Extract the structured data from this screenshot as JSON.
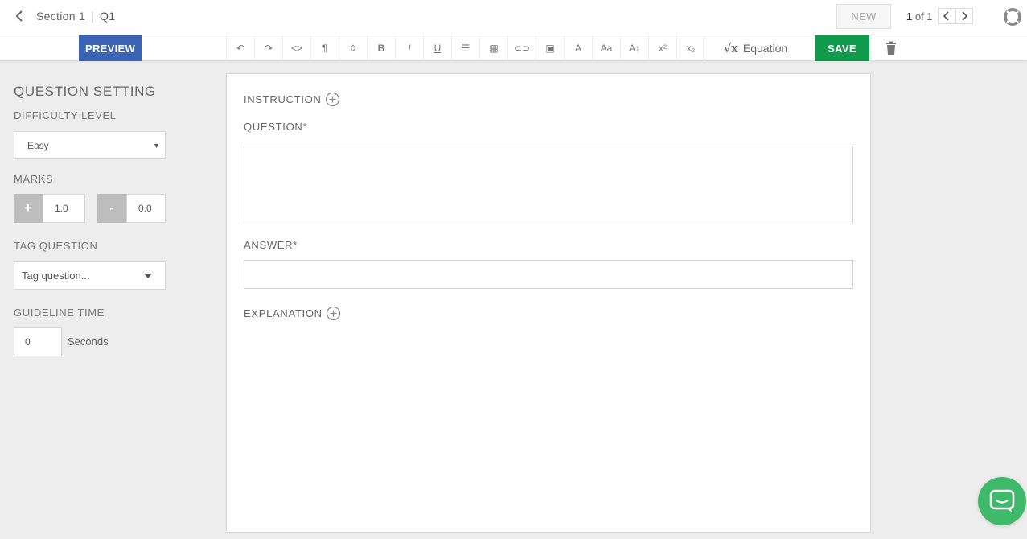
{
  "header": {
    "section": "Section 1",
    "separator": "|",
    "question_id": "Q1",
    "new_label": "NEW",
    "pager_current": "1",
    "pager_rest": " of 1"
  },
  "toolbar": {
    "preview_label": "PREVIEW",
    "tools": [
      {
        "name": "undo-icon",
        "glyph": "↶"
      },
      {
        "name": "redo-icon",
        "glyph": "↷"
      },
      {
        "name": "code-icon",
        "glyph": "<>"
      },
      {
        "name": "paragraph-icon",
        "glyph": "¶"
      },
      {
        "name": "color-drop-icon",
        "glyph": "◊"
      },
      {
        "name": "bold-icon",
        "glyph": "B"
      },
      {
        "name": "italic-icon",
        "glyph": "I"
      },
      {
        "name": "underline-icon",
        "glyph": "U"
      },
      {
        "name": "bullet-list-icon",
        "glyph": "☰"
      },
      {
        "name": "table-icon",
        "glyph": "▦"
      },
      {
        "name": "link-icon",
        "glyph": "⊂⊃"
      },
      {
        "name": "image-icon",
        "glyph": "▣"
      },
      {
        "name": "text-color-icon",
        "glyph": "A"
      },
      {
        "name": "font-family-icon",
        "glyph": "Aa"
      },
      {
        "name": "font-size-icon",
        "glyph": "A↕"
      },
      {
        "name": "superscript-icon",
        "glyph": "x²"
      },
      {
        "name": "subscript-icon",
        "glyph": "x₂"
      }
    ],
    "equation_symbol": "√x",
    "equation_label": "Equation",
    "save_label": "SAVE"
  },
  "sidebar": {
    "title": "QUESTION SETTING",
    "difficulty_label": "DIFFICULTY LEVEL",
    "difficulty_value": "Easy",
    "marks_label": "MARKS",
    "plus_label": "+",
    "plus_value": "1.0",
    "minus_label": "-",
    "minus_value": "0.0",
    "tag_label": "TAG QUESTION",
    "tag_placeholder": "Tag question...",
    "guideline_label": "GUIDELINE TIME",
    "guideline_value": "0",
    "guideline_unit": "Seconds"
  },
  "editor": {
    "instruction_label": "INSTRUCTION",
    "question_label": "QUESTION*",
    "answer_label": "ANSWER*",
    "explanation_label": "EXPLANATION"
  },
  "colors": {
    "preview": "#3b64b5",
    "save": "#109a4c",
    "chat": "#3fb96a"
  }
}
